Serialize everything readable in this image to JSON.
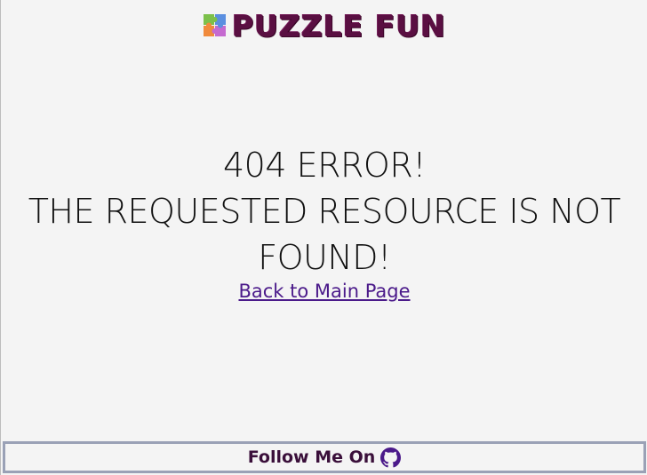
{
  "header": {
    "logo_icon": "puzzle-piece-icon",
    "brand_name": "PUZZLE FUN"
  },
  "main": {
    "error_title": "404 ERROR!",
    "message_line1": "THE REQUESTED RESOURCE IS NOT",
    "message_line2": "FOUND!",
    "back_link_label": "Back to Main Page"
  },
  "footer": {
    "follow_label": "Follow Me On",
    "social_icon": "github-icon"
  },
  "colors": {
    "background": "#f4f4f4",
    "brand": "#5a0f42",
    "link": "#4b1a8a",
    "footer_border": "#9aa1b6"
  }
}
